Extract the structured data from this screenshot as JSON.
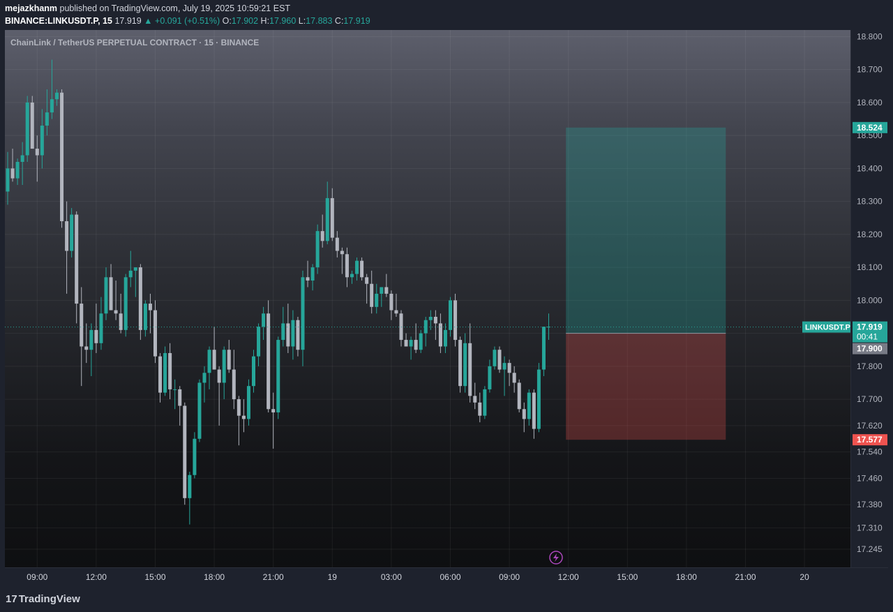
{
  "header": {
    "publisher": "mejazkhanm",
    "published_text": " published on TradingView.com, July 19, 2025 10:59:21 EST",
    "symbol": "BINANCE:LINKUSDT.P, 15",
    "last": "17.919",
    "change": "▲ +0.091 (+0.51%)",
    "o_label": "O:",
    "o_value": "17.902",
    "h_label": "H:",
    "h_value": "17.960",
    "l_label": "L:",
    "l_value": "17.883",
    "c_label": "C:",
    "c_value": "17.919"
  },
  "chart_title": "ChainLink / TetherUS PERPETUAL CONTRACT · 15 · BINANCE",
  "footer": {
    "logo_text": "TradingView"
  },
  "colors": {
    "up": "#26a69a",
    "down": "#b2b5be",
    "target": "#26a69a",
    "stop": "#ef5350",
    "line": "#26a69a"
  },
  "chart_data": {
    "type": "candlestick",
    "title": "ChainLink / TetherUS PERPETUAL CONTRACT · 15 · BINANCE",
    "ylim": [
      17.19,
      18.82
    ],
    "y_ticks": [
      "18.800",
      "18.700",
      "18.600",
      "18.500",
      "18.400",
      "18.300",
      "18.200",
      "18.100",
      "18.000",
      "17.900",
      "17.800",
      "17.700",
      "17.620",
      "17.540",
      "17.460",
      "17.380",
      "17.310",
      "17.245"
    ],
    "x_start": "07:30",
    "x_interval": "15m",
    "x_ticks": [
      {
        "index": 6,
        "label": "09:00"
      },
      {
        "index": 18,
        "label": "12:00"
      },
      {
        "index": 30,
        "label": "15:00"
      },
      {
        "index": 42,
        "label": "18:00"
      },
      {
        "index": 54,
        "label": "21:00"
      },
      {
        "index": 66,
        "label": "19"
      },
      {
        "index": 78,
        "label": "03:00"
      },
      {
        "index": 90,
        "label": "06:00"
      },
      {
        "index": 102,
        "label": "09:00"
      },
      {
        "index": 114,
        "label": "12:00"
      },
      {
        "index": 126,
        "label": "15:00"
      },
      {
        "index": 138,
        "label": "18:00"
      },
      {
        "index": 150,
        "label": "21:00"
      },
      {
        "index": 162,
        "label": "20"
      }
    ],
    "candles": [
      [
        18.33,
        18.45,
        18.29,
        18.4
      ],
      [
        18.4,
        18.46,
        18.36,
        18.37
      ],
      [
        18.37,
        18.43,
        18.35,
        18.42
      ],
      [
        18.42,
        18.48,
        18.35,
        18.44
      ],
      [
        18.44,
        18.62,
        18.42,
        18.6
      ],
      [
        18.6,
        18.62,
        18.46,
        18.46
      ],
      [
        18.46,
        18.5,
        18.36,
        18.44
      ],
      [
        18.44,
        18.58,
        18.4,
        18.53
      ],
      [
        18.53,
        18.64,
        18.5,
        18.57
      ],
      [
        18.57,
        18.73,
        18.55,
        18.61
      ],
      [
        18.61,
        18.64,
        18.59,
        18.63
      ],
      [
        18.63,
        18.64,
        18.22,
        18.24
      ],
      [
        18.24,
        18.3,
        18.02,
        18.15
      ],
      [
        18.15,
        18.28,
        18.13,
        18.26
      ],
      [
        18.26,
        18.27,
        17.93,
        17.99
      ],
      [
        17.99,
        18.04,
        17.74,
        17.86
      ],
      [
        17.86,
        17.93,
        17.81,
        17.85
      ],
      [
        17.85,
        17.93,
        17.77,
        17.91
      ],
      [
        17.91,
        17.99,
        17.84,
        17.87
      ],
      [
        17.87,
        18.01,
        17.85,
        17.96
      ],
      [
        17.96,
        18.1,
        17.94,
        18.07
      ],
      [
        18.07,
        18.11,
        17.97,
        17.97
      ],
      [
        17.97,
        18.06,
        17.94,
        17.96
      ],
      [
        17.96,
        18.02,
        17.9,
        17.91
      ],
      [
        17.91,
        18.08,
        17.89,
        18.07
      ],
      [
        18.07,
        18.15,
        18.04,
        18.09
      ],
      [
        18.09,
        18.1,
        18.01,
        18.1
      ],
      [
        18.1,
        18.11,
        17.88,
        17.91
      ],
      [
        17.91,
        18.0,
        17.89,
        17.99
      ],
      [
        17.99,
        18.02,
        17.9,
        17.97
      ],
      [
        17.97,
        18.0,
        17.81,
        17.83
      ],
      [
        17.83,
        17.84,
        17.69,
        17.72
      ],
      [
        17.72,
        17.86,
        17.71,
        17.84
      ],
      [
        17.84,
        17.87,
        17.7,
        17.73
      ],
      [
        17.73,
        17.76,
        17.67,
        17.73
      ],
      [
        17.73,
        17.74,
        17.62,
        17.68
      ],
      [
        17.68,
        17.69,
        17.38,
        17.4
      ],
      [
        17.4,
        17.48,
        17.32,
        17.47
      ],
      [
        17.47,
        17.6,
        17.46,
        17.58
      ],
      [
        17.58,
        17.76,
        17.57,
        17.75
      ],
      [
        17.75,
        17.8,
        17.69,
        17.78
      ],
      [
        17.78,
        17.86,
        17.73,
        17.85
      ],
      [
        17.85,
        17.92,
        17.79,
        17.79
      ],
      [
        17.79,
        17.8,
        17.62,
        17.75
      ],
      [
        17.75,
        17.86,
        17.7,
        17.85
      ],
      [
        17.85,
        17.88,
        17.78,
        17.79
      ],
      [
        17.79,
        17.85,
        17.67,
        17.7
      ],
      [
        17.7,
        17.71,
        17.56,
        17.65
      ],
      [
        17.65,
        17.7,
        17.6,
        17.64
      ],
      [
        17.64,
        17.76,
        17.62,
        17.74
      ],
      [
        17.74,
        17.85,
        17.72,
        17.83
      ],
      [
        17.83,
        17.93,
        17.8,
        17.92
      ],
      [
        17.92,
        17.98,
        17.88,
        17.96
      ],
      [
        17.96,
        18.0,
        17.66,
        17.67
      ],
      [
        17.67,
        17.72,
        17.55,
        17.66
      ],
      [
        17.66,
        17.89,
        17.64,
        17.88
      ],
      [
        17.88,
        17.98,
        17.86,
        17.93
      ],
      [
        17.93,
        17.99,
        17.84,
        17.86
      ],
      [
        17.86,
        17.97,
        17.82,
        17.94
      ],
      [
        17.94,
        17.95,
        17.83,
        17.85
      ],
      [
        17.85,
        18.09,
        17.8,
        18.07
      ],
      [
        18.07,
        18.12,
        18.04,
        18.06
      ],
      [
        18.06,
        18.11,
        18.03,
        18.1
      ],
      [
        18.1,
        18.23,
        18.08,
        18.21
      ],
      [
        18.21,
        18.26,
        18.16,
        18.18
      ],
      [
        18.18,
        18.36,
        18.17,
        18.31
      ],
      [
        18.31,
        18.34,
        18.18,
        18.19
      ],
      [
        18.19,
        18.21,
        18.13,
        18.15
      ],
      [
        18.15,
        18.16,
        18.08,
        18.14
      ],
      [
        18.14,
        18.16,
        18.04,
        18.07
      ],
      [
        18.07,
        18.09,
        18.05,
        18.08
      ],
      [
        18.08,
        18.13,
        18.06,
        18.12
      ],
      [
        18.12,
        18.13,
        18.06,
        18.07
      ],
      [
        18.07,
        18.08,
        17.99,
        18.05
      ],
      [
        18.05,
        18.09,
        17.96,
        17.98
      ],
      [
        17.98,
        18.05,
        17.96,
        18.02
      ],
      [
        18.02,
        18.04,
        17.98,
        18.04
      ],
      [
        18.04,
        18.08,
        18.01,
        18.02
      ],
      [
        18.02,
        18.03,
        17.94,
        17.97
      ],
      [
        17.97,
        18.02,
        17.95,
        17.96
      ],
      [
        17.96,
        17.97,
        17.86,
        17.88
      ],
      [
        17.88,
        17.9,
        17.86,
        17.86
      ],
      [
        17.86,
        17.89,
        17.82,
        17.88
      ],
      [
        17.88,
        17.93,
        17.84,
        17.85
      ],
      [
        17.85,
        17.91,
        17.84,
        17.9
      ],
      [
        17.9,
        17.95,
        17.86,
        17.94
      ],
      [
        17.94,
        17.97,
        17.91,
        17.95
      ],
      [
        17.95,
        17.97,
        17.88,
        17.93
      ],
      [
        17.93,
        17.96,
        17.84,
        17.86
      ],
      [
        17.86,
        17.93,
        17.84,
        17.91
      ],
      [
        17.91,
        18.01,
        17.89,
        18.0
      ],
      [
        18.0,
        18.02,
        17.86,
        17.88
      ],
      [
        17.88,
        17.89,
        17.72,
        17.74
      ],
      [
        17.74,
        17.9,
        17.72,
        17.87
      ],
      [
        17.87,
        17.93,
        17.69,
        17.71
      ],
      [
        17.71,
        17.75,
        17.67,
        17.69
      ],
      [
        17.69,
        17.72,
        17.63,
        17.65
      ],
      [
        17.65,
        17.74,
        17.64,
        17.73
      ],
      [
        17.73,
        17.82,
        17.72,
        17.8
      ],
      [
        17.8,
        17.86,
        17.79,
        17.85
      ],
      [
        17.85,
        17.86,
        17.78,
        17.79
      ],
      [
        17.79,
        17.83,
        17.71,
        17.81
      ],
      [
        17.81,
        17.82,
        17.74,
        17.78
      ],
      [
        17.78,
        17.8,
        17.72,
        17.75
      ],
      [
        17.75,
        17.76,
        17.66,
        17.67
      ],
      [
        17.67,
        17.69,
        17.6,
        17.64
      ],
      [
        17.64,
        17.73,
        17.62,
        17.72
      ],
      [
        17.72,
        17.73,
        17.58,
        17.61
      ],
      [
        17.61,
        17.81,
        17.6,
        17.79
      ],
      [
        17.79,
        17.9,
        17.77,
        17.92
      ],
      [
        17.92,
        17.96,
        17.88,
        17.92
      ]
    ],
    "last_price": 17.919,
    "current_price_label": "LINKUSDT.P",
    "current_price": "17.919",
    "countdown": "00:41",
    "long_position": {
      "entry": 17.9,
      "entry_label": "17.900",
      "target": 18.524,
      "target_label": "18.524",
      "stop": 17.577,
      "stop_label": "17.577",
      "start_index": 113.5,
      "end_index": 146
    }
  }
}
